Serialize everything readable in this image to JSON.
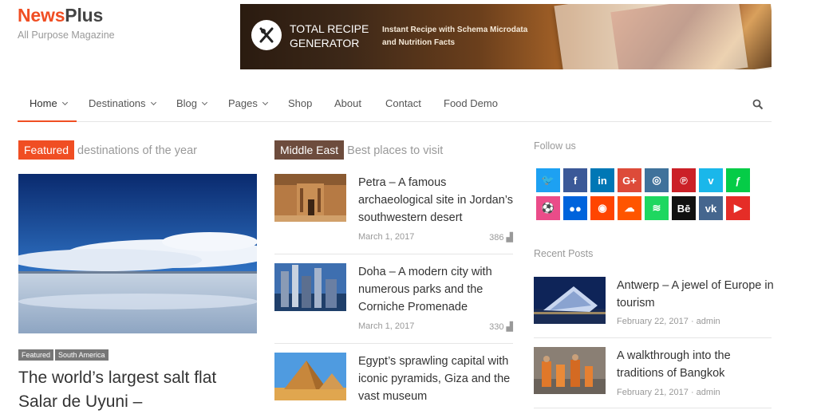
{
  "brand": {
    "name_part1": "News",
    "name_part2": "Plus",
    "tagline": "All Purpose Magazine"
  },
  "banner": {
    "title": "TOTAL RECIPE GENERATOR",
    "subtitle": "Instant Recipe with Schema Microdata and Nutrition Facts",
    "icon": "fork-knife-icon"
  },
  "nav": {
    "items": [
      {
        "label": "Home",
        "dropdown": true
      },
      {
        "label": "Destinations",
        "dropdown": true
      },
      {
        "label": "Blog",
        "dropdown": true
      },
      {
        "label": "Pages",
        "dropdown": true
      },
      {
        "label": "Shop",
        "dropdown": false
      },
      {
        "label": "About",
        "dropdown": false
      },
      {
        "label": "Contact",
        "dropdown": false
      },
      {
        "label": "Food Demo",
        "dropdown": false
      }
    ],
    "active": "Home",
    "search_icon": "search-icon"
  },
  "featured": {
    "tag": "Featured",
    "heading": "destinations of the year",
    "chips": [
      "Featured",
      "South America"
    ],
    "title": "The world’s largest salt flat Salar de Uyuni –"
  },
  "middle": {
    "tag": "Middle East",
    "heading": "Best places to visit",
    "posts": [
      {
        "title": "Petra – A famous archaeological site in Jordan’s southwestern desert",
        "date": "March 1, 2017",
        "views": "386"
      },
      {
        "title": "Doha – A modern city with numerous parks and the Corniche Promenade",
        "date": "March 1, 2017",
        "views": "330"
      },
      {
        "title": "Egypt’s sprawling capital with iconic pyramids, Giza and the vast museum",
        "date": "",
        "views": ""
      }
    ]
  },
  "sidebar": {
    "follow_heading": "Follow us",
    "social": [
      {
        "name": "twitter",
        "glyph": "🐦",
        "color": "#1da1f2"
      },
      {
        "name": "facebook",
        "glyph": "f",
        "color": "#3b5998"
      },
      {
        "name": "linkedin",
        "glyph": "in",
        "color": "#0077b5"
      },
      {
        "name": "google-plus",
        "glyph": "G+",
        "color": "#dd4b39"
      },
      {
        "name": "instagram",
        "glyph": "◎",
        "color": "#3f729b"
      },
      {
        "name": "pinterest",
        "glyph": "℗",
        "color": "#cb2027"
      },
      {
        "name": "vimeo",
        "glyph": "v",
        "color": "#1ab7ea"
      },
      {
        "name": "deviantart",
        "glyph": "ƒ",
        "color": "#05cc47"
      },
      {
        "name": "dribbble",
        "glyph": "⚽",
        "color": "#ea4c89"
      },
      {
        "name": "flickr",
        "glyph": "●●",
        "color": "#0063dc"
      },
      {
        "name": "reddit",
        "glyph": "◉",
        "color": "#ff4500"
      },
      {
        "name": "soundcloud",
        "glyph": "☁",
        "color": "#ff5500"
      },
      {
        "name": "spotify",
        "glyph": "≋",
        "color": "#1ed760"
      },
      {
        "name": "behance",
        "glyph": "Bē",
        "color": "#111111"
      },
      {
        "name": "vk",
        "glyph": "vk",
        "color": "#45668e"
      },
      {
        "name": "youtube",
        "glyph": "▶",
        "color": "#e52d27"
      }
    ],
    "recent_heading": "Recent Posts",
    "recent": [
      {
        "title": "Antwerp – A jewel of Europe in tourism",
        "date": "February 22, 2017",
        "author": "admin"
      },
      {
        "title": "A walkthrough into the traditions of Bangkok",
        "date": "February 21, 2017",
        "author": "admin"
      }
    ]
  },
  "colors": {
    "accent": "#f04e23",
    "brown_tag": "#6d4c3d"
  }
}
